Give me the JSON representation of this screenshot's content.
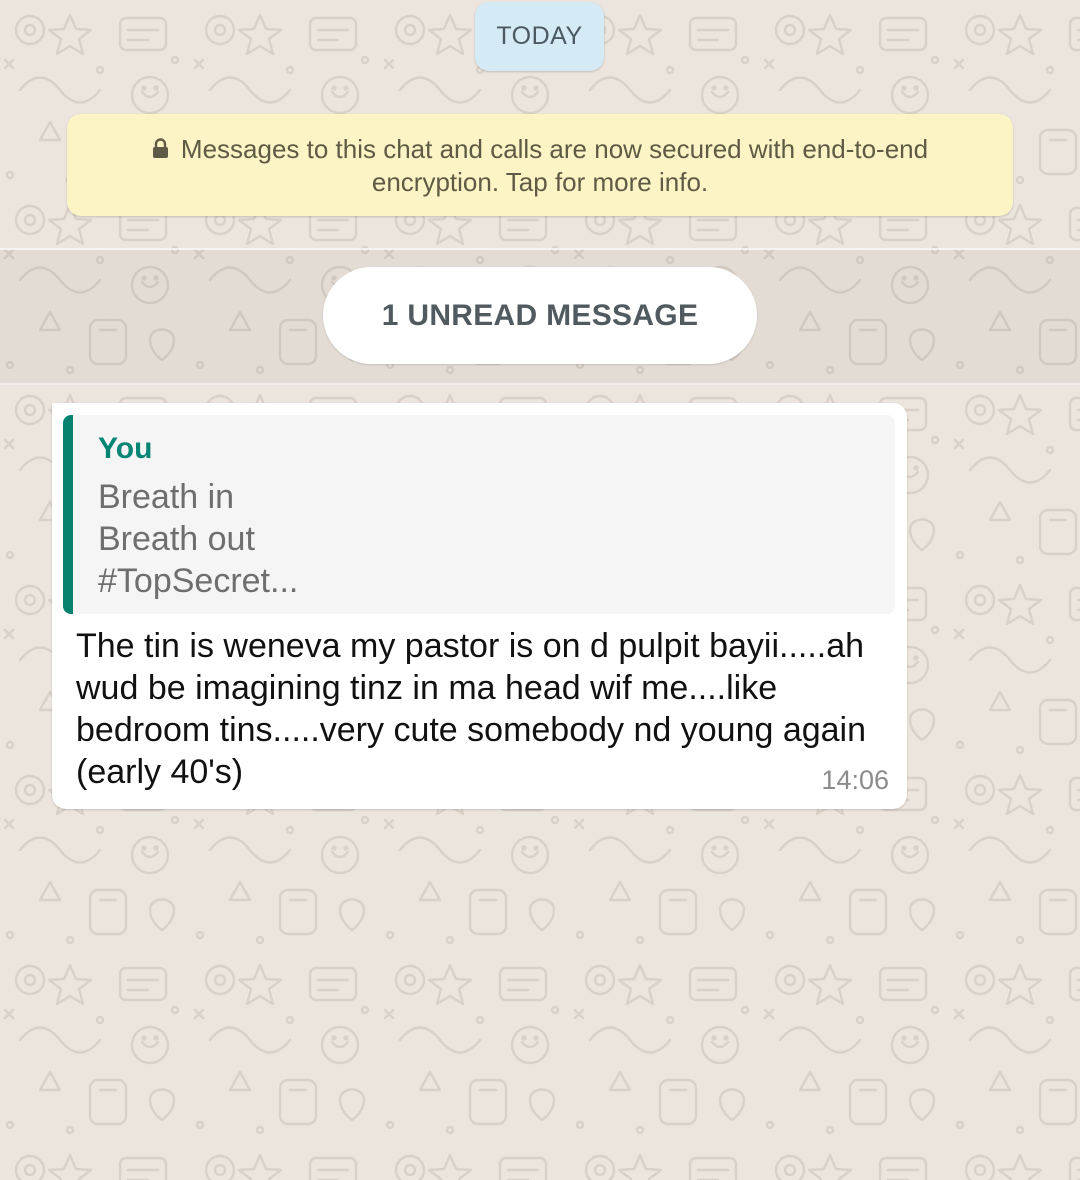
{
  "chat": {
    "date_divider": "TODAY",
    "encryption_notice": "Messages to this chat and calls are now secured with end-to-end encryption. Tap for more info.",
    "unread_divider": "1 UNREAD MESSAGE",
    "message": {
      "quoted": {
        "author": "You",
        "lines": [
          "Breath in",
          "Breath out",
          "#TopSecret..."
        ]
      },
      "text": "The tin is weneva my pastor is on d pulpit bayii.....ah wud be imagining tinz in ma head wif me....like bedroom tins.....very cute somebody nd young again (early 40's)",
      "time": "14:06"
    }
  },
  "icons": {
    "encryption_notice": "lock-icon"
  },
  "colors": {
    "wallpaper": "#ece5dd",
    "date_chip": "#d4eaf4",
    "encryption_notice": "#fdf4c5",
    "quote_accent": "#06826f",
    "quote_author": "#078575",
    "bubble": "#ffffff"
  }
}
